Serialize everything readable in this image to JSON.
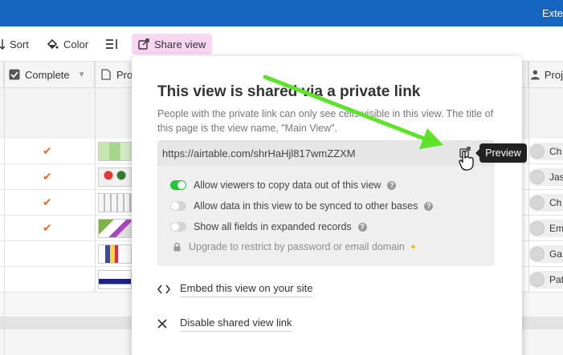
{
  "topbar": {
    "ext_label": "Exte"
  },
  "toolbar": {
    "sort_label": "Sort",
    "color_label": "Color",
    "share_label": "Share view"
  },
  "grid": {
    "columns": [
      "Complete",
      "Proj",
      "Proj"
    ],
    "rows": [
      {
        "complete": true,
        "person": "Ch"
      },
      {
        "complete": true,
        "person": "Jas"
      },
      {
        "complete": true,
        "person": "Ch"
      },
      {
        "complete": true,
        "person": "Em"
      },
      {
        "complete": false,
        "person": "Ga"
      },
      {
        "complete": false,
        "person": "Pat"
      }
    ]
  },
  "popover": {
    "title": "This view is shared via a private link",
    "description": "People with the private link can only see cells visible in this view. The title of this page is the view name, \"Main View\".",
    "url": "https://airtable.com/shrHaHjl817wmZZXM",
    "options": [
      {
        "label": "Allow viewers to copy data out of this view",
        "on": true
      },
      {
        "label": "Allow data in this view to be synced to other bases",
        "on": false
      },
      {
        "label": "Show all fields in expanded records",
        "on": false
      }
    ],
    "upgrade_label": "Upgrade to restrict by password or email domain",
    "embed_label": "Embed this view on your site",
    "disable_label": "Disable shared view link"
  },
  "tooltip": {
    "label": "Preview"
  },
  "colors": {
    "topbar": "#1565c0",
    "share_button_bg": "#f9d6f2",
    "toggle_on": "#20c933",
    "checkmark": "#f06b28",
    "arrow": "#5de329"
  }
}
